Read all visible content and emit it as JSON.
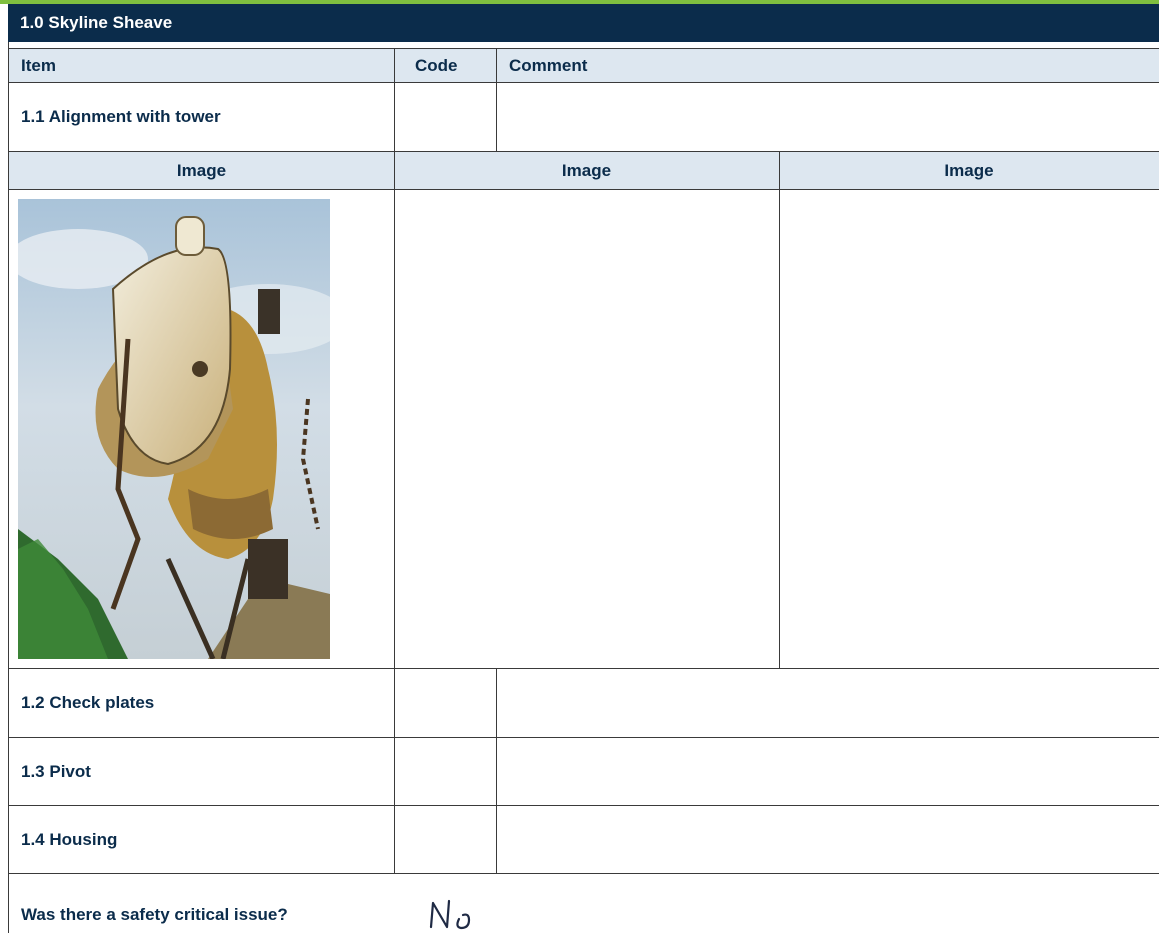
{
  "section": {
    "title": "1.0 Skyline Sheave"
  },
  "table_header": {
    "item": "Item",
    "code": "Code",
    "comment": "Comment"
  },
  "rows": [
    {
      "item": "1.1  Alignment with tower",
      "code": "",
      "comment": ""
    },
    {
      "item": "1.2  Check plates",
      "code": "",
      "comment": ""
    },
    {
      "item": "1.3  Pivot",
      "code": "",
      "comment": ""
    },
    {
      "item": "1.4  Housing",
      "code": "",
      "comment": ""
    }
  ],
  "image_headers": [
    "Image",
    "Image",
    "Image"
  ],
  "safety": {
    "question": "Was there a safety critical issue?",
    "answer": "No"
  },
  "colors": {
    "header_bg": "#0b2c4b",
    "band_bg": "#dde7f0",
    "accent": "#7fbf3f",
    "label_text": "#0b2c4b"
  }
}
